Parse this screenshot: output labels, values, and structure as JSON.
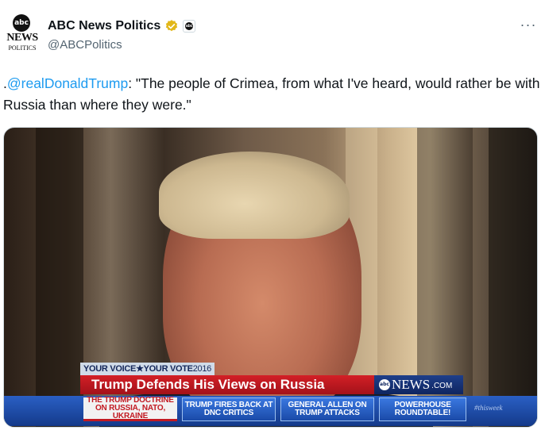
{
  "author": {
    "display_name": "ABC News Politics",
    "handle": "@ABCPolitics",
    "avatar_logo_text": "abc",
    "avatar_news_text": "NEWS",
    "avatar_politics_text": "POLITICS",
    "affiliate_badge_text": "abc"
  },
  "more_label": "···",
  "tweet": {
    "prefix": ".",
    "mention": "@realDonaldTrump",
    "body": ": \"The people of Crimea, from what I've heard, would rather be with Russia than where they were.\""
  },
  "media": {
    "topline_main": "YOUR VOICE★YOUR VOTE",
    "topline_year": "2016",
    "headline": "Trump Defends His Views on Russia",
    "brand_logo": "abc",
    "brand_news": "NEWS",
    "brand_com": ".COM",
    "ticker_items": [
      "THE TRUMP DOCTRINE ON RUSSIA, NATO, UKRAINE",
      "TRUMP FIRES BACK AT DNC CRITICS",
      "GENERAL ALLEN ON TRUMP ATTACKS",
      "POWERHOUSE ROUNDTABLE!"
    ],
    "hashtag": "#thisweek"
  },
  "colors": {
    "mention": "#1d9bf0",
    "verified_gold": "#e2b719",
    "headline_red": "#d31f26",
    "ticker_blue": "#1e4fb0"
  }
}
